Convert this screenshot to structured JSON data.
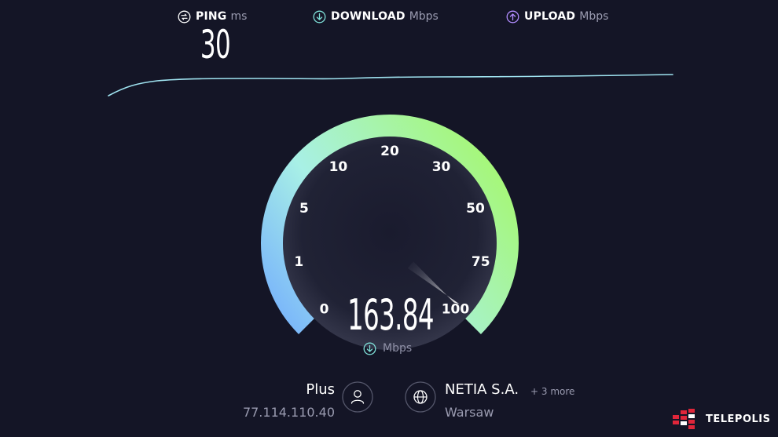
{
  "metrics": {
    "ping": {
      "label": "PING",
      "unit": "ms",
      "value": "30",
      "icon": "ping-icon"
    },
    "download": {
      "label": "DOWNLOAD",
      "unit": "Mbps",
      "icon": "download-arrow-icon"
    },
    "upload": {
      "label": "UPLOAD",
      "unit": "Mbps",
      "icon": "upload-arrow-icon"
    }
  },
  "gauge": {
    "ticks": [
      "0",
      "1",
      "5",
      "10",
      "20",
      "30",
      "50",
      "75",
      "100"
    ],
    "current_value": "163.84",
    "unit": "Mbps",
    "needle_fraction": 1.0
  },
  "connection": {
    "host_name": "Plus",
    "host_ip": "77.114.110.40",
    "server_name": "NETIA S.A.",
    "server_more": "+ 3 more",
    "server_city": "Warsaw"
  },
  "brand": {
    "name": "TELEPOLIS"
  },
  "colors": {
    "background": "#141526",
    "gauge_start": "#6fa8ff",
    "gauge_mid": "#a8f0e6",
    "gauge_end": "#a6f77a",
    "graph_line": "#9fe3f0",
    "download_accent": "#7fe0d8",
    "upload_accent": "#b18cff",
    "brand_red": "#e0263a"
  }
}
